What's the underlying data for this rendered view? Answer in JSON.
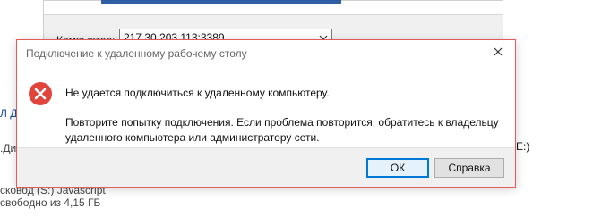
{
  "background": {
    "left_blue_text": "Л ДИ",
    "left_text_1": ".Ди",
    "left_text_2": "сковод (S:) Javascript",
    "left_text_3": "свободно из 4,15 ГБ",
    "right_text": "E:)"
  },
  "rdp_window": {
    "computer_label": "Компьютер:",
    "computer_value": "217.30.203.113:3389"
  },
  "error_dialog": {
    "title": "Подключение к удаленному рабочему столу",
    "message_primary": "Не удается подключиться к удаленному компьютеру.",
    "message_secondary": "Повторите попытку подключения. Если проблема повторится, обратитесь к владельцу удаленного компьютера или администратору сети.",
    "ok_button": "ОК",
    "help_button": "Справка",
    "icons": {
      "error": "error-icon",
      "close": "close-icon"
    }
  },
  "colors": {
    "error_red": "#e0443b",
    "accent_blue": "#0078d7"
  }
}
